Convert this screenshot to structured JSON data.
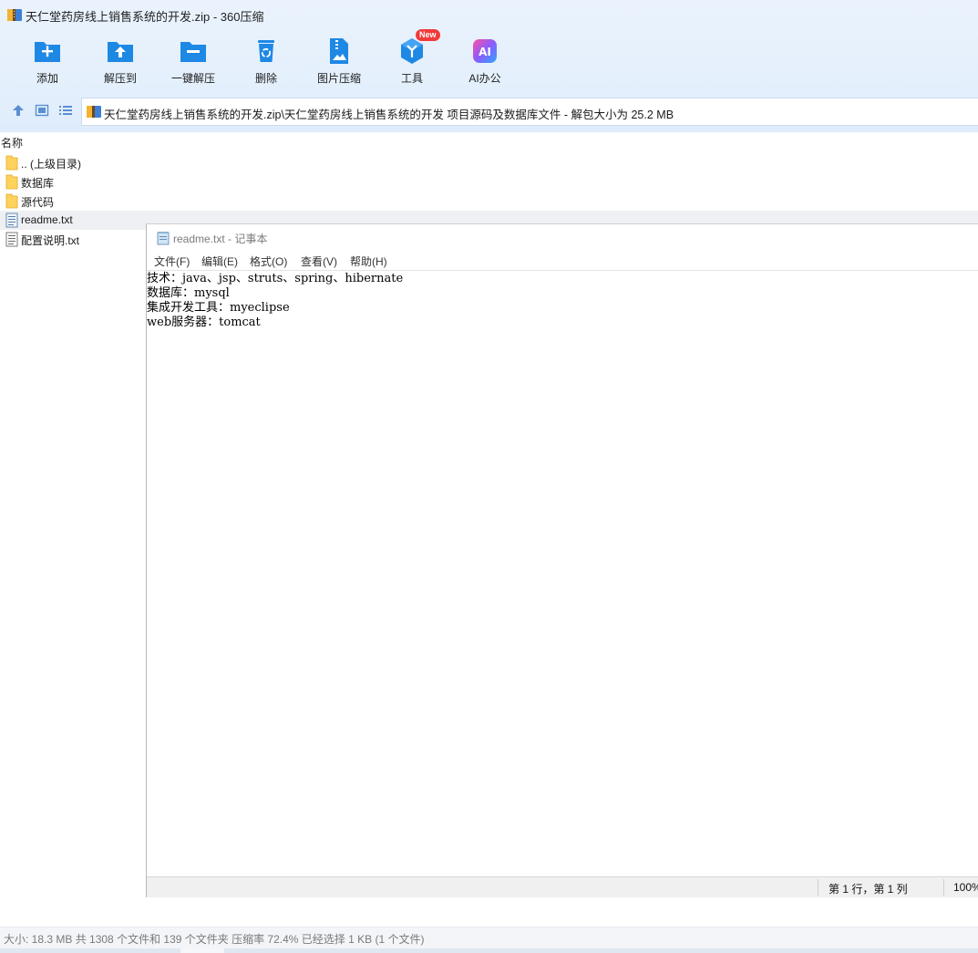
{
  "window": {
    "title": "天仁堂药房线上销售系统的开发.zip - 360压缩"
  },
  "toolbar": {
    "buttons": [
      {
        "label": "添加",
        "icon": "add-folder-icon"
      },
      {
        "label": "解压到",
        "icon": "extract-to-icon"
      },
      {
        "label": "一键解压",
        "icon": "one-click-extract-icon"
      },
      {
        "label": "删除",
        "icon": "recycle-bin-icon"
      },
      {
        "label": "图片压缩",
        "icon": "image-compress-icon"
      },
      {
        "label": "工具",
        "icon": "tools-icon",
        "badge": "New"
      },
      {
        "label": "AI办公",
        "icon": "ai-office-icon"
      }
    ]
  },
  "path": {
    "text": "天仁堂药房线上销售系统的开发.zip\\天仁堂药房线上销售系统的开发 项目源码及数据库文件 - 解包大小为 25.2 MB"
  },
  "file_list": {
    "column_name": "名称",
    "items": [
      {
        "name": ".. (上级目录)",
        "type": "folder"
      },
      {
        "name": "数据库",
        "type": "folder"
      },
      {
        "name": "源代码",
        "type": "folder"
      },
      {
        "name": "readme.txt",
        "type": "text-file",
        "selected": true
      },
      {
        "name": "配置说明.txt",
        "type": "text-file"
      }
    ]
  },
  "notepad": {
    "title": "readme.txt - 记事本",
    "menu": [
      "文件(F)",
      "编辑(E)",
      "格式(O)",
      "查看(V)",
      "帮助(H)"
    ],
    "lines": [
      "技术：java、jsp、struts、spring、hibernate",
      "数据库：mysql",
      "集成开发工具：myeclipse",
      "web服务器：tomcat"
    ],
    "status_position": "第 1 行，第 1 列",
    "status_zoom": "100%"
  },
  "status": {
    "text": "大小: 18.3 MB 共 1308 个文件和 139 个文件夹 压缩率 72.4% 已经选择 1 KB (1 个文件)"
  },
  "colors": {
    "accent": "#1e88e5",
    "chrome_bg": "#e3effc",
    "selected_row": "#eef0f3",
    "folder": "#ffd25c",
    "badge": "#f23a3a"
  }
}
